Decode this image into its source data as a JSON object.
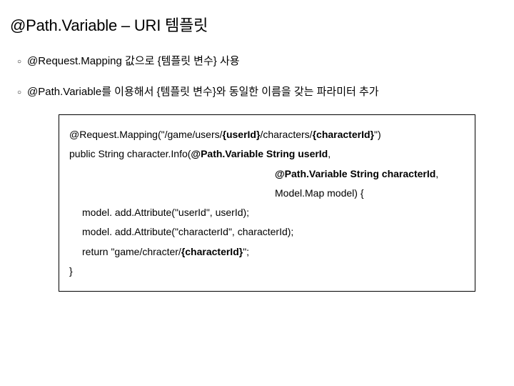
{
  "title": "@Path.Variable – URI 템플릿",
  "bullets": [
    "@Request.Mapping 값으로 {템플릿 변수} 사용",
    "@Path.Variable를 이용해서 {템플릿 변수}와 동일한 이름을 갖는 파라미터 추가"
  ],
  "code": {
    "l1_pre": "@Request.Mapping(\"/game/users/",
    "l1_bold": "{userId}",
    "l1_mid": "/characters/",
    "l1_bold2": "{characterId}",
    "l1_end": "\")",
    "l2_pre": "public String character.Info(",
    "l2_bold": "@Path.Variable String userId",
    "l2_end": ",",
    "l3_bold": "@Path.Variable String characterId",
    "l3_end": ",",
    "l4": "Model.Map model) {",
    "l5": "model. add.Attribute(\"userId\", userId);",
    "l6": "model. add.Attribute(\"characterId\", characterId);",
    "l7_pre": "return \"game/chracter/",
    "l7_bold": "{characterId}",
    "l7_end": "\";",
    "l8": "}"
  }
}
